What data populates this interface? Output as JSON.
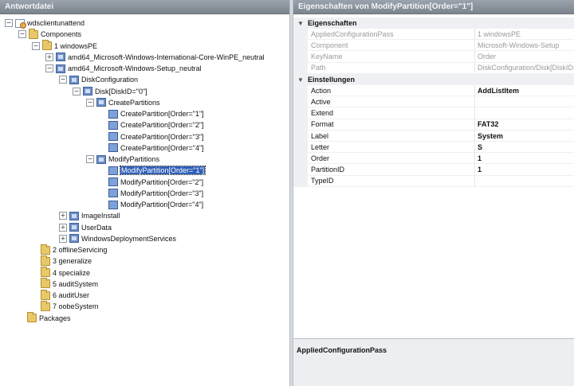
{
  "left": {
    "title": "Antwortdatei",
    "tree": [
      {
        "label": "wdsclientunattend",
        "icon": "cfg",
        "exp": "-"
      },
      {
        "label": "Components",
        "icon": "folder",
        "exp": "-"
      },
      {
        "label": "1 windowsPE",
        "icon": "folder",
        "exp": "-"
      },
      {
        "label": "amd64_Microsoft-Windows-International-Core-WinPE_neutral",
        "icon": "comp",
        "exp": "+"
      },
      {
        "label": "amd64_Microsoft-Windows-Setup_neutral",
        "icon": "comp",
        "exp": "-"
      },
      {
        "label": "DiskConfiguration",
        "icon": "comp",
        "exp": "-"
      },
      {
        "label": "Disk[DiskID=\"0\"]",
        "icon": "comp",
        "exp": "-"
      },
      {
        "label": "CreatePartitions",
        "icon": "comp",
        "exp": "-"
      },
      {
        "label": "CreatePartition[Order=\"1\"]",
        "icon": "filled",
        "exp": ""
      },
      {
        "label": "CreatePartition[Order=\"2\"]",
        "icon": "filled",
        "exp": ""
      },
      {
        "label": "CreatePartition[Order=\"3\"]",
        "icon": "filled",
        "exp": ""
      },
      {
        "label": "CreatePartition[Order=\"4\"]",
        "icon": "filled",
        "exp": ""
      },
      {
        "label": "ModifyPartitions",
        "icon": "comp",
        "exp": "-"
      },
      {
        "label": "ModifyPartition[Order=\"1\"]",
        "icon": "filled",
        "exp": "",
        "selected": true
      },
      {
        "label": "ModifyPartition[Order=\"2\"]",
        "icon": "filled",
        "exp": ""
      },
      {
        "label": "ModifyPartition[Order=\"3\"]",
        "icon": "filled",
        "exp": ""
      },
      {
        "label": "ModifyPartition[Order=\"4\"]",
        "icon": "filled",
        "exp": ""
      },
      {
        "label": "ImageInstall",
        "icon": "comp",
        "exp": "+"
      },
      {
        "label": "UserData",
        "icon": "comp",
        "exp": "+"
      },
      {
        "label": "WindowsDeploymentServices",
        "icon": "comp",
        "exp": "+"
      },
      {
        "label": "2 offlineServicing",
        "icon": "folder",
        "exp": ""
      },
      {
        "label": "3 generalize",
        "icon": "folder",
        "exp": ""
      },
      {
        "label": "4 specialize",
        "icon": "folder",
        "exp": ""
      },
      {
        "label": "5 auditSystem",
        "icon": "folder",
        "exp": ""
      },
      {
        "label": "6 auditUser",
        "icon": "folder",
        "exp": ""
      },
      {
        "label": "7 oobeSystem",
        "icon": "folder",
        "exp": ""
      },
      {
        "label": "Packages",
        "icon": "folder",
        "exp": ""
      }
    ]
  },
  "right": {
    "title": "Eigenschaften von ModifyPartition[Order=\"1\"]",
    "categories": [
      {
        "name": "Eigenschaften",
        "rows": [
          {
            "name": "AppliedConfigurationPass",
            "value": "1 windowsPE"
          },
          {
            "name": "Component",
            "value": "Microsoft-Windows-Setup"
          },
          {
            "name": "KeyName",
            "value": "Order"
          },
          {
            "name": "Path",
            "value": "DiskConfiguration/Disk[DiskID=\"0\"]"
          }
        ]
      },
      {
        "name": "Einstellungen",
        "rows": [
          {
            "name": "Action",
            "value": "AddListItem"
          },
          {
            "name": "Active",
            "value": ""
          },
          {
            "name": "Extend",
            "value": ""
          },
          {
            "name": "Format",
            "value": "FAT32"
          },
          {
            "name": "Label",
            "value": "System"
          },
          {
            "name": "Letter",
            "value": "S"
          },
          {
            "name": "Order",
            "value": "1"
          },
          {
            "name": "PartitionID",
            "value": "1"
          },
          {
            "name": "TypeID",
            "value": ""
          }
        ]
      }
    ],
    "description": "AppliedConfigurationPass"
  }
}
